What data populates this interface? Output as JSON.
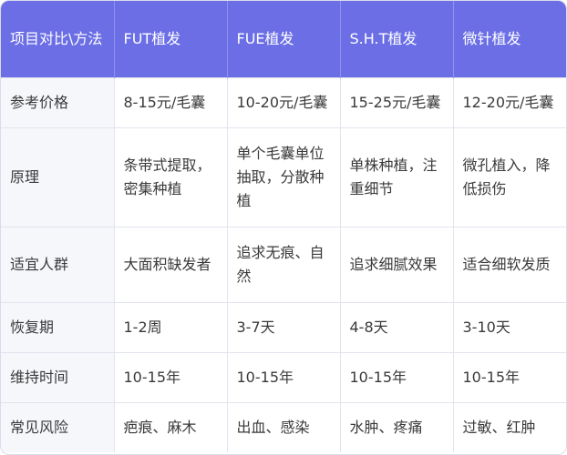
{
  "table": {
    "headers": [
      "项目对比\\方法",
      "FUT植发",
      "FUE植发",
      "S.H.T植发",
      "微针植发"
    ],
    "rows": [
      {
        "label": "参考价格",
        "cells": [
          "8-15元/毛囊",
          "10-20元/毛囊",
          "15-25元/毛囊",
          "12-20元/毛囊"
        ]
      },
      {
        "label": "原理",
        "cells": [
          "条带式提取，密集种植",
          "单个毛囊单位抽取，分散种植",
          "单株种植，注重细节",
          "微孔植入，降低损伤"
        ]
      },
      {
        "label": "适宜人群",
        "cells": [
          "大面积缺发者",
          "追求无痕、自然",
          "追求细腻效果",
          "适合细软发质"
        ]
      },
      {
        "label": "恢复期",
        "cells": [
          "1-2周",
          "3-7天",
          "4-8天",
          "3-10天"
        ]
      },
      {
        "label": "维持时间",
        "cells": [
          "10-15年",
          "10-15年",
          "10-15年",
          "10-15年"
        ]
      },
      {
        "label": "常见风险",
        "cells": [
          "疤痕、麻木",
          "出血、感染",
          "水肿、疼痛",
          "过敏、红肿"
        ]
      }
    ]
  },
  "colors": {
    "header_bg": "#6b6ee5",
    "header_text": "#ffffff",
    "label_bg": "#f6f7fb",
    "border": "#e2e4ee",
    "text": "#3a3a3a"
  }
}
